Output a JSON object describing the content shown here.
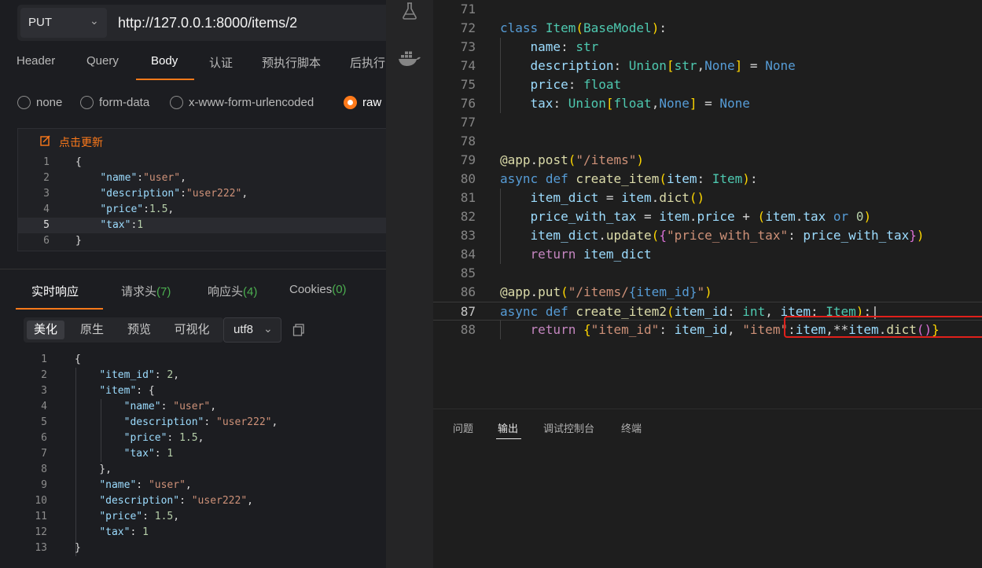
{
  "request": {
    "method": "PUT",
    "url": "http://127.0.0.1:8000/items/2",
    "tabs": [
      "Header",
      "Query",
      "Body",
      "认证",
      "预执行脚本",
      "后执行"
    ],
    "active_tab": "Body",
    "body_types": [
      "none",
      "form-data",
      "x-www-form-urlencoded",
      "raw"
    ],
    "selected_body_type": "raw",
    "refresh_label": "点击更新",
    "body_lines": [
      {
        "n": "1",
        "t": "{"
      },
      {
        "n": "2",
        "t": "    \"name\":\"user\","
      },
      {
        "n": "3",
        "t": "    \"description\":\"user222\","
      },
      {
        "n": "4",
        "t": "    \"price\":1.5,"
      },
      {
        "n": "5",
        "t": "    \"tax\":1"
      },
      {
        "n": "6",
        "t": "}"
      }
    ]
  },
  "response": {
    "tabs": [
      {
        "label": "实时响应",
        "count": ""
      },
      {
        "label": "请求头",
        "count": "(7)"
      },
      {
        "label": "响应头",
        "count": "(4)"
      },
      {
        "label": "Cookies",
        "count": "(0)"
      }
    ],
    "view_modes": [
      "美化",
      "原生",
      "预览",
      "可视化"
    ],
    "active_view": "美化",
    "encoding": "utf8",
    "lines": [
      {
        "n": "1",
        "t": "{"
      },
      {
        "n": "2",
        "t": "    \"item_id\": 2,"
      },
      {
        "n": "3",
        "t": "    \"item\": {"
      },
      {
        "n": "4",
        "t": "        \"name\": \"user\","
      },
      {
        "n": "5",
        "t": "        \"description\": \"user222\","
      },
      {
        "n": "6",
        "t": "        \"price\": 1.5,"
      },
      {
        "n": "7",
        "t": "        \"tax\": 1"
      },
      {
        "n": "8",
        "t": "    },"
      },
      {
        "n": "9",
        "t": "    \"name\": \"user\","
      },
      {
        "n": "10",
        "t": "    \"description\": \"user222\","
      },
      {
        "n": "11",
        "t": "    \"price\": 1.5,"
      },
      {
        "n": "12",
        "t": "    \"tax\": 1"
      },
      {
        "n": "13",
        "t": "}"
      }
    ]
  },
  "editor": {
    "current_line": "87",
    "lines": [
      {
        "n": "71",
        "t": ""
      },
      {
        "n": "72",
        "t": "class Item(BaseModel):"
      },
      {
        "n": "73",
        "t": "    name: str"
      },
      {
        "n": "74",
        "t": "    description: Union[str,None] = None"
      },
      {
        "n": "75",
        "t": "    price: float"
      },
      {
        "n": "76",
        "t": "    tax: Union[float,None] = None"
      },
      {
        "n": "77",
        "t": ""
      },
      {
        "n": "78",
        "t": ""
      },
      {
        "n": "79",
        "t": "@app.post(\"/items\")"
      },
      {
        "n": "80",
        "t": "async def create_item(item: Item):"
      },
      {
        "n": "81",
        "t": "    item_dict = item.dict()"
      },
      {
        "n": "82",
        "t": "    price_with_tax = item.price + (item.tax or 0)"
      },
      {
        "n": "83",
        "t": "    item_dict.update({\"price_with_tax\": price_with_tax})"
      },
      {
        "n": "84",
        "t": "    return item_dict"
      },
      {
        "n": "85",
        "t": ""
      },
      {
        "n": "86",
        "t": "@app.put(\"/items/{item_id}\")"
      },
      {
        "n": "87",
        "t": "async def create_item2(item_id: int, item: Item):"
      },
      {
        "n": "88",
        "t": "    return {\"item_id\": item_id, \"item\":item,**item.dict()}"
      }
    ],
    "highlight_color": "#e0201b"
  },
  "panel": {
    "tabs": [
      "问题",
      "输出",
      "调试控制台",
      "终端"
    ],
    "active_tab": "输出"
  },
  "activity_icons": [
    "flask-icon",
    "docker-icon"
  ],
  "accent_color": "#ff7a1a"
}
